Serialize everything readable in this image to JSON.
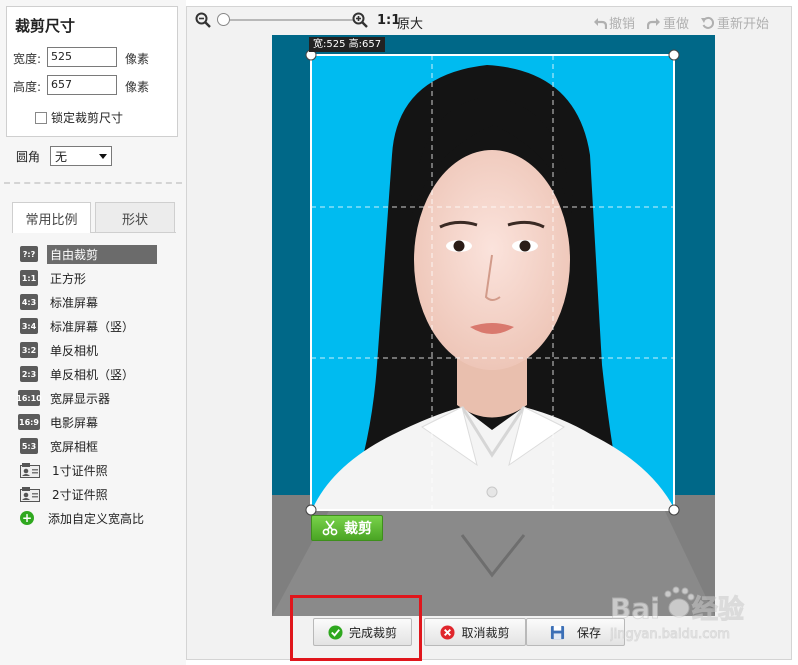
{
  "crop_size": {
    "title": "裁剪尺寸",
    "width_label": "宽度:",
    "width_value": "525",
    "height_label": "高度:",
    "height_value": "657",
    "unit": "像素",
    "lock_label": "锁定裁剪尺寸",
    "lock_checked": false
  },
  "corner": {
    "label": "圆角",
    "value": "无"
  },
  "tabs": [
    {
      "label": "常用比例",
      "active": true
    },
    {
      "label": "形状",
      "active": false
    }
  ],
  "ratios": [
    {
      "badge": "?:?",
      "label": "自由裁剪",
      "selected": true
    },
    {
      "badge": "1:1",
      "label": "正方形"
    },
    {
      "badge": "4:3",
      "label": "标准屏幕"
    },
    {
      "badge": "3:4",
      "label": "标准屏幕（竖）"
    },
    {
      "badge": "3:2",
      "label": "单反相机"
    },
    {
      "badge": "2:3",
      "label": "单反相机（竖）"
    },
    {
      "badge": "16:10",
      "label": "宽屏显示器"
    },
    {
      "badge": "16:9",
      "label": "电影屏幕"
    },
    {
      "badge": "5:3",
      "label": "宽屏相框"
    },
    {
      "badge": "id-card-icon",
      "label": "1寸证件照"
    },
    {
      "badge": "id-card-icon",
      "label": "2寸证件照"
    },
    {
      "badge": "plus-icon",
      "label": "添加自定义宽高比"
    }
  ],
  "toolbar": {
    "original_ratio": "1:1",
    "original_label": "原大",
    "zoom_level": 0,
    "undo": "撤销",
    "redo": "重做",
    "restart": "重新开始"
  },
  "crop": {
    "dimension_label": "宽:525 高:657",
    "crop_button": "裁剪"
  },
  "bottom": {
    "finish": "完成裁剪",
    "cancel": "取消裁剪",
    "save": "保存"
  },
  "watermark": {
    "brand": "Baidu经验",
    "url": "jingyan.baidu.com"
  },
  "colors": {
    "photo_bg": "#00bbf0",
    "outer_bg": "#006888",
    "crop_green": "#57b82e",
    "highlight_red": "#e0161c",
    "finish_check": "#2fa81f",
    "cancel_x": "#e0262c"
  }
}
